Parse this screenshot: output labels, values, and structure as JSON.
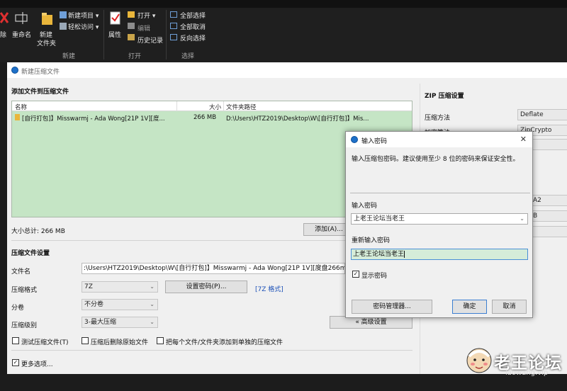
{
  "ribbon": {
    "delete_label": "除",
    "rename_label": "重命名",
    "new_folder_label": "新建\n文件夹",
    "new_item_label": "新建项目",
    "easy_access_label": "轻松访问",
    "properties_label": "属性",
    "open_label": "打开",
    "edit_label": "编辑",
    "history_label": "历史记录",
    "select_all_label": "全部选择",
    "select_none_label": "全部取消",
    "invert_selection_label": "反向选择",
    "group_new": "新建",
    "group_open": "打开",
    "group_select": "选择"
  },
  "window": {
    "title": "新建压缩文件",
    "add_section_title": "添加文件到压缩文件",
    "columns": [
      "名称",
      "大小",
      "文件夹路径"
    ],
    "rows": [
      {
        "name": "[自行打包]】Misswarmj - Ada Wong[21P 1V][度...",
        "size": "266 MB",
        "path": "D:\\Users\\HTZ2019\\Desktop\\W\\[自行打包]】Mis..."
      }
    ],
    "total_label": "大小总计: 266 MB",
    "add_button": "添加(A)...",
    "settings_title": "压缩文件设置",
    "file_name_label": "文件名",
    "file_name_value": ":\\Users\\HTZ2019\\Desktop\\W\\[自行打包]】Misswarmj - Ada Wong[21P 1V][度盘266mb].",
    "format_label": "压缩格式",
    "format_value": "7Z",
    "set_password_button": "设置密码(P)...",
    "format_link": "[7Z 格式]",
    "split_label": "分卷",
    "split_value": "不分卷",
    "level_label": "压缩级别",
    "level_value": "3-最大压缩",
    "advanced_button": "« 高级设置",
    "test_checkbox": "测试压缩文件(T)",
    "delete_checkbox": "压缩后删除原始文件",
    "each_file_checkbox": "把每个文件/文件夹添加到单独的压缩文件",
    "more_options": "更多选项..."
  },
  "zip_settings": {
    "title": "ZIP 压缩设置",
    "method_label": "压缩方法",
    "method_value": "Deflate",
    "encrypt_label": "加密算法",
    "encrypt_value": "ZipCrypto",
    "partial_1": "A2",
    "partial_2": "B"
  },
  "password_dialog": {
    "title": "输入密码",
    "description": "输入压缩包密码。建议使用至少 8 位的密码来保证安全性。",
    "password_label": "输入密码",
    "password_value": "上老王论坛当老王",
    "confirm_label": "重新输入密码",
    "confirm_value": "上老王论坛当老王",
    "show_password": "显示密码",
    "manager_button": "密码管理器...",
    "ok_button": "确定",
    "cancel_button": "取消"
  },
  "watermark": {
    "title": "老王论坛",
    "site": "laowang.vip"
  }
}
